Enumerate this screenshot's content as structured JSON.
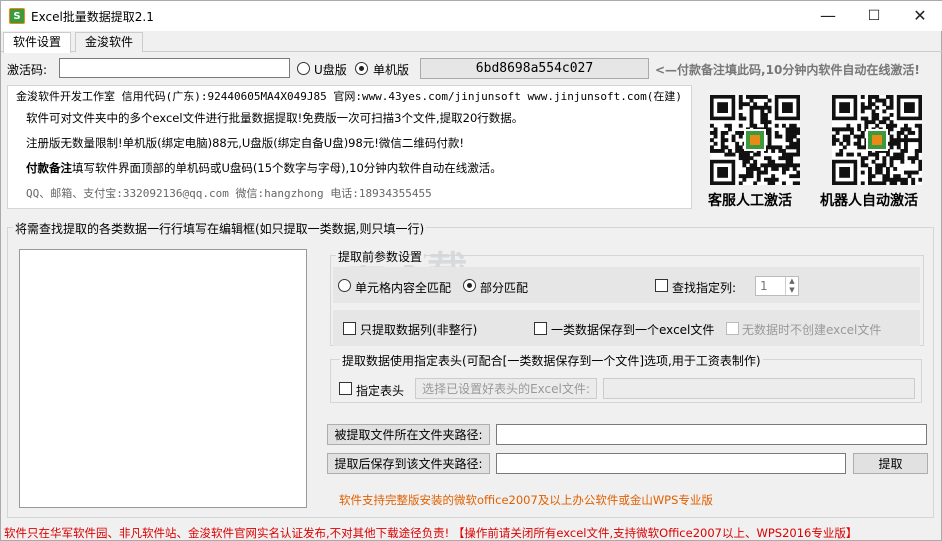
{
  "window": {
    "title": "Excel批量数据提取2.1",
    "icon_text": "S"
  },
  "window_buttons": {
    "minimize": "—",
    "maximize": "☐",
    "close": "✕"
  },
  "tabs": [
    {
      "label": "软件设置"
    },
    {
      "label": "金浚软件"
    }
  ],
  "activation": {
    "label": "激活码:",
    "value": "",
    "usb_label": "U盘版",
    "pc_label": "单机版",
    "machine_code": "6bd8698a554c027",
    "hint": "<—付款备注填此码,10分钟内软件自动在线激活!"
  },
  "info": {
    "company": "金浚软件开发工作室 信用代码(广东):92440605MA4X049J85 官网:www.43yes.com/jinjunsoft  www.jinjunsoft.com(在建)",
    "line1": "软件可对文件夹中的多个excel文件进行批量数据提取!免费版一次可扫描3个文件,提取20行数据。",
    "line2": "注册版无数量限制!单机版(绑定电脑)88元,U盘版(绑定自备U盘)98元!微信二维码付款!",
    "line3_bold": "付款备注",
    "line3": "填写软件界面顶部的单机码或U盘码(15个数字与字母),10分钟内软件自动在线激活。",
    "contact": "QQ、邮箱、支付宝:332092136@qq.com  微信:hangzhong  电话:18934355455"
  },
  "qr": [
    {
      "caption": "客服人工激活"
    },
    {
      "caption": "机器人自动激活"
    }
  ],
  "search_group": {
    "title": "将需查找提取的各类数据一行行填写在编辑框(如只提取一类数据,则只填一行)"
  },
  "params": {
    "title": "提取前参数设置",
    "full_match": "单元格内容全匹配",
    "partial_match": "部分匹配",
    "find_column": "查找指定列:",
    "column_value": "1",
    "only_column": "只提取数据列(非整行)",
    "one_file": "一类数据保存到一个excel文件",
    "no_data": "无数据时不创建excel文件"
  },
  "header_group": {
    "title": "提取数据使用指定表头(可配合[一类数据保存到一个文件]选项,用于工资表制作)",
    "checkbox": "指定表头",
    "choose_btn": "选择已设置好表头的Excel文件:",
    "path_value": ""
  },
  "paths": {
    "source_btn": "被提取文件所在文件夹路径:",
    "source_value": "",
    "target_btn": "提取后保存到该文件夹路径:",
    "target_value": "",
    "extract_btn": "提取"
  },
  "notes": {
    "support": "软件支持完整版安装的微软office2007及以上办公软件或金山WPS专业版",
    "footer": "软件只在华军软件园、非凡软件站、金浚软件官网实名认证发布,不对其他下载途径负责! 【操作前请关闭所有excel文件,支持微软Office2007以上、WPS2016专业版】"
  },
  "watermark": "安下载"
}
